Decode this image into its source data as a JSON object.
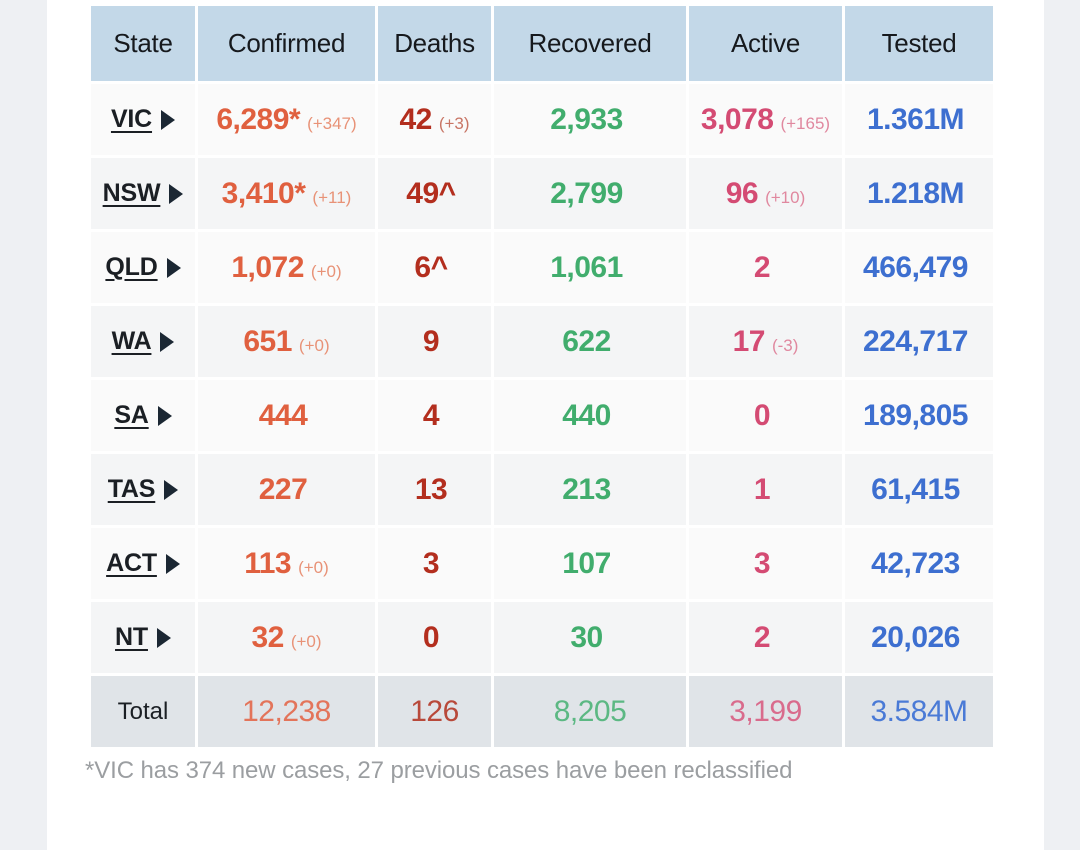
{
  "table": {
    "columns": [
      "State",
      "Confirmed",
      "Deaths",
      "Recovered",
      "Active",
      "Tested"
    ],
    "rows": [
      {
        "state": "VIC",
        "confirmed": "6,289*",
        "confirmed_delta": "(+347)",
        "deaths": "42",
        "deaths_delta": "(+3)",
        "recovered": "2,933",
        "recovered_delta": "",
        "active": "3,078",
        "active_delta": "(+165)",
        "tested": "1.361M",
        "tested_delta": ""
      },
      {
        "state": "NSW",
        "confirmed": "3,410*",
        "confirmed_delta": "(+11)",
        "deaths": "49^",
        "deaths_delta": "",
        "recovered": "2,799",
        "recovered_delta": "",
        "active": "96",
        "active_delta": "(+10)",
        "tested": "1.218M",
        "tested_delta": ""
      },
      {
        "state": "QLD",
        "confirmed": "1,072",
        "confirmed_delta": "(+0)",
        "deaths": "6^",
        "deaths_delta": "",
        "recovered": "1,061",
        "recovered_delta": "",
        "active": "2",
        "active_delta": "",
        "tested": "466,479",
        "tested_delta": ""
      },
      {
        "state": "WA",
        "confirmed": "651",
        "confirmed_delta": "(+0)",
        "deaths": "9",
        "deaths_delta": "",
        "recovered": "622",
        "recovered_delta": "",
        "active": "17",
        "active_delta": "(-3)",
        "tested": "224,717",
        "tested_delta": ""
      },
      {
        "state": "SA",
        "confirmed": "444",
        "confirmed_delta": "",
        "deaths": "4",
        "deaths_delta": "",
        "recovered": "440",
        "recovered_delta": "",
        "active": "0",
        "active_delta": "",
        "tested": "189,805",
        "tested_delta": ""
      },
      {
        "state": "TAS",
        "confirmed": "227",
        "confirmed_delta": "",
        "deaths": "13",
        "deaths_delta": "",
        "recovered": "213",
        "recovered_delta": "",
        "active": "1",
        "active_delta": "",
        "tested": "61,415",
        "tested_delta": ""
      },
      {
        "state": "ACT",
        "confirmed": "113",
        "confirmed_delta": "(+0)",
        "deaths": "3",
        "deaths_delta": "",
        "recovered": "107",
        "recovered_delta": "",
        "active": "3",
        "active_delta": "",
        "tested": "42,723",
        "tested_delta": ""
      },
      {
        "state": "NT",
        "confirmed": "32",
        "confirmed_delta": "(+0)",
        "deaths": "0",
        "deaths_delta": "",
        "recovered": "30",
        "recovered_delta": "",
        "active": "2",
        "active_delta": "",
        "tested": "20,026",
        "tested_delta": ""
      }
    ],
    "total": {
      "state": "Total",
      "confirmed": "12,238",
      "confirmed_delta": "",
      "deaths": "126",
      "deaths_delta": "",
      "recovered": "8,205",
      "recovered_delta": "",
      "active": "3,199",
      "active_delta": "",
      "tested": "3.584M",
      "tested_delta": ""
    }
  },
  "footnote": {
    "text": "*VIC has 374 new cases, 27 previous cases have been reclassified"
  },
  "colors": {
    "header_bg": "#c3d8e8",
    "row_bg": "#fafafa",
    "row_bg_alt": "#f4f5f6",
    "total_bg": "#e0e4e8",
    "confirmed": "#e0603f",
    "deaths": "#b32e1e",
    "recovered": "#41ad6d",
    "active": "#d44b73",
    "tested": "#3d6fd0",
    "footnote": "#9b9ea1"
  },
  "chart_data": {
    "type": "table",
    "title": "COVID-19 cases by Australian state/territory",
    "columns": [
      "State",
      "Confirmed",
      "Deaths",
      "Recovered",
      "Active",
      "Tested"
    ],
    "categories": [
      "VIC",
      "NSW",
      "QLD",
      "WA",
      "SA",
      "TAS",
      "ACT",
      "NT",
      "Total"
    ],
    "series": [
      {
        "name": "Confirmed",
        "values": [
          6289,
          3410,
          1072,
          651,
          444,
          227,
          113,
          32,
          12238
        ]
      },
      {
        "name": "Confirmed change",
        "values": [
          347,
          11,
          0,
          0,
          null,
          null,
          0,
          0,
          null
        ]
      },
      {
        "name": "Deaths",
        "values": [
          42,
          49,
          6,
          9,
          4,
          13,
          3,
          0,
          126
        ]
      },
      {
        "name": "Deaths change",
        "values": [
          3,
          null,
          null,
          null,
          null,
          null,
          null,
          null,
          null
        ]
      },
      {
        "name": "Recovered",
        "values": [
          2933,
          2799,
          1061,
          622,
          440,
          213,
          107,
          30,
          8205
        ]
      },
      {
        "name": "Active",
        "values": [
          3078,
          96,
          2,
          17,
          0,
          1,
          3,
          2,
          3199
        ]
      },
      {
        "name": "Active change",
        "values": [
          165,
          10,
          null,
          -3,
          null,
          null,
          null,
          null,
          null
        ]
      },
      {
        "name": "Tested",
        "values": [
          1361000,
          1218000,
          466479,
          224717,
          189805,
          61415,
          42723,
          20026,
          3584000
        ]
      }
    ],
    "annotations": [
      "*VIC has 374 new cases, 27 previous cases have been reclassified"
    ]
  }
}
